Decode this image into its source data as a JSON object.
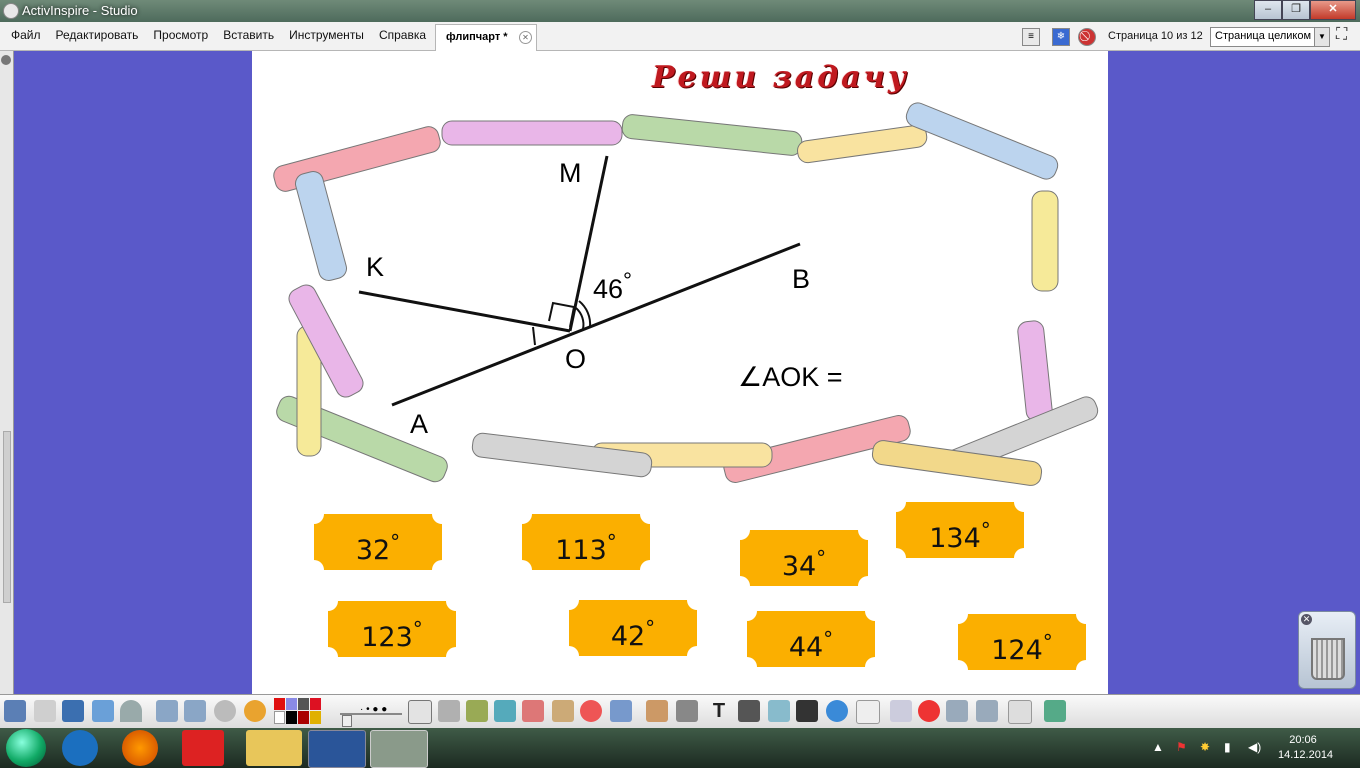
{
  "window": {
    "title": "ActivInspire - Studio"
  },
  "menu": [
    "Файл",
    "Редактировать",
    "Просмотр",
    "Вставить",
    "Инструменты",
    "Справка"
  ],
  "tab": {
    "label": "флипчарт *"
  },
  "pager": {
    "label": "Страница 10 из 12",
    "zoom": "Страница целиком"
  },
  "slide": {
    "heading": "Реши задачу",
    "labels": {
      "m": "M",
      "k": "K",
      "b": "B",
      "o": "O",
      "a": "A",
      "angle": "46",
      "question": "∠AOK ="
    }
  },
  "answers": [
    {
      "value": "32",
      "deg": "°"
    },
    {
      "value": "113",
      "deg": "°"
    },
    {
      "value": "34",
      "deg": "°"
    },
    {
      "value": "134",
      "deg": "°"
    },
    {
      "value": "123",
      "deg": "°"
    },
    {
      "value": "42",
      "deg": "°"
    },
    {
      "value": "44",
      "deg": "°"
    },
    {
      "value": "124",
      "deg": "°"
    }
  ],
  "taskbar": {
    "time": "20:06",
    "date": "14.12.2014"
  },
  "colors": {
    "accent": "#fbaf00",
    "desktop": "#5a59c9",
    "heading": "#c0191f"
  }
}
